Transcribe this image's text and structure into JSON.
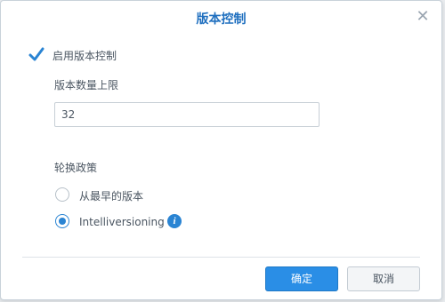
{
  "dialog": {
    "title": "版本控制",
    "close_glyph": "✕"
  },
  "enable_versioning": {
    "label": "启用版本控制",
    "checked": true
  },
  "max_versions": {
    "label": "版本数量上限",
    "value": "32"
  },
  "rotation_policy": {
    "label": "轮换政策",
    "options": [
      {
        "label": "从最早的版本",
        "selected": false
      },
      {
        "label": "Intelliversioning",
        "selected": true
      }
    ],
    "info_glyph": "i"
  },
  "buttons": {
    "ok": "确定",
    "cancel": "取消"
  },
  "colors": {
    "accent": "#2a8ee6",
    "title": "#1f6fbf"
  },
  "icons": [
    "check-icon",
    "close-icon",
    "info-icon"
  ]
}
